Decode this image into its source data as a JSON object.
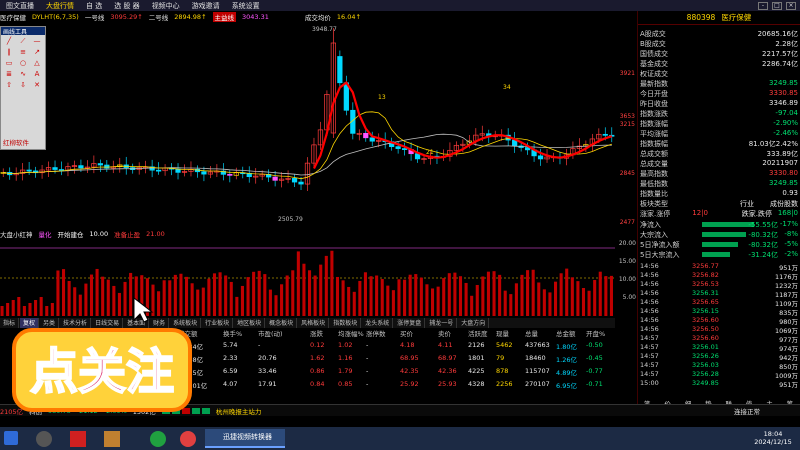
{
  "menubar": {
    "items": [
      "图文直播",
      "大盘行情",
      "自 选",
      "选 股 器",
      "视频中心",
      "游戏邀请",
      "系统设置"
    ],
    "highlight_index": 1,
    "controls": [
      "-",
      "□",
      "×"
    ]
  },
  "infobar": {
    "name": "医疗保健",
    "indicator": "DYLHT(6,7,35)",
    "line1_label": "一号线",
    "line1_value": "3095.29↑",
    "line2_label": "二号线",
    "line2_value": "2894.98↑",
    "tag": "主益线",
    "tag_value": "3043.31",
    "avg_label": "成交均价",
    "avg_value": "16.04↑"
  },
  "main_chart": {
    "y_ticks": [
      "3921",
      "3653",
      "3215",
      "2845",
      "2477"
    ],
    "high_label": "3948.77",
    "low_label": "2505.79",
    "annotations": [
      "13",
      "34",
      "21"
    ]
  },
  "indicator_bar": {
    "name": "大盘小红神",
    "a": "量化",
    "b": "开始建仓",
    "b_val": "10.00",
    "c": "准备止盈",
    "c_val": "21.00"
  },
  "vol_y_ticks": [
    "20.00",
    "15.00",
    "10.00",
    "5.00"
  ],
  "tabs": [
    "指标",
    "复权",
    "另类",
    "技术分析",
    "日线交易",
    "基本面",
    "财务",
    "系统板块",
    "行业板块",
    "地区板块",
    "概念板块",
    "风格板块",
    "指数板块",
    "龙头系统",
    "涨停复盘",
    "捕龙一号",
    "大盘方向"
  ],
  "tabs_active": 1,
  "table": {
    "headers": [
      "成交额",
      "换手%",
      "市盈(动)",
      "涨跌",
      "均涨幅%",
      "涨停数",
      "买价",
      "卖价",
      "活跃度",
      "现量",
      "总量",
      "总金额",
      "开盘%"
    ],
    "rows": [
      [
        "31.34亿",
        "5.74",
        "-",
        "0.12",
        "1.02",
        "-",
        "4.18",
        "4.11",
        "2126",
        "5462",
        "437663",
        "1.80亿",
        "-0.50"
      ],
      [
        "54.68亿",
        "2.33",
        "20.76",
        "1.62",
        "1.16",
        "-",
        "68.95",
        "68.97",
        "1801",
        "79",
        "18460",
        "1.26亿",
        "-0.45"
      ],
      [
        "74.35亿",
        "6.59",
        "33.46",
        "0.86",
        "1.79",
        "-",
        "42.35",
        "42.36",
        "4225",
        "878",
        "115707",
        "4.89亿",
        "-0.77"
      ],
      [
        "172.01亿",
        "4.07",
        "17.91",
        "0.84",
        "0.85",
        "-",
        "25.92",
        "25.93",
        "4328",
        "2256",
        "270107",
        "6.95亿",
        "-0.71"
      ]
    ]
  },
  "panel": {
    "code": "880398",
    "name": "医疗保健",
    "rows": [
      {
        "k": "A股成交",
        "v": "20685.16亿",
        "c": "c-wht"
      },
      {
        "k": "B股成交",
        "v": "2.28亿",
        "c": "c-wht"
      },
      {
        "k": "国债成交",
        "v": "2217.57亿",
        "c": "c-wht"
      },
      {
        "k": "基金成交",
        "v": "2286.74亿",
        "c": "c-wht"
      },
      {
        "k": "权证成交",
        "v": "",
        "c": "c-wht"
      },
      {
        "k": "最新指数",
        "v": "3249.85",
        "c": "c-grn"
      },
      {
        "k": "今日开盘",
        "v": "3330.85",
        "c": "c-red"
      },
      {
        "k": "昨日收盘",
        "v": "3346.89",
        "c": "c-wht"
      },
      {
        "k": "指数涨跌",
        "v": "-97.04",
        "c": "c-grn"
      },
      {
        "k": "指数涨幅",
        "v": "-2.90%",
        "c": "c-grn"
      },
      {
        "k": "平均涨幅",
        "v": "-2.46%",
        "c": "c-grn"
      },
      {
        "k": "指数振幅",
        "v": "81.03亿2.42%",
        "c": "c-wht"
      },
      {
        "k": "总成交额",
        "v": "333.89亿",
        "c": "c-wht"
      },
      {
        "k": "总成交量",
        "v": "20211907",
        "c": "c-wht"
      },
      {
        "k": "最高指数",
        "v": "3330.80",
        "c": "c-red"
      },
      {
        "k": "最低指数",
        "v": "3249.85",
        "c": "c-grn"
      },
      {
        "k": "指数量比",
        "v": "0.93",
        "c": "c-wht"
      }
    ],
    "sector": {
      "k": "板块类型",
      "v1": "行业",
      "v2": "成份股数"
    },
    "updown": {
      "k": "涨家.涨停",
      "v1": "12|0",
      "v2": "跌家.跌停",
      "v3": "168|0"
    },
    "flows": [
      {
        "k": "净流入",
        "v": "-55.55亿",
        "p": "-17%"
      },
      {
        "k": "大宗流入",
        "v": "-80.32亿",
        "p": "-8%"
      },
      {
        "k": "5日净流入额",
        "v": "-80.32亿",
        "p": "-5%"
      },
      {
        "k": "5日大宗流入",
        "v": "-31.24亿",
        "p": "-2%"
      }
    ],
    "ticks": [
      [
        "14:56",
        "3256.77",
        "951万"
      ],
      [
        "14:56",
        "3256.82",
        "1176万"
      ],
      [
        "14:56",
        "3256.53",
        "1232万"
      ],
      [
        "14:56",
        "3256.31",
        "1187万"
      ],
      [
        "14:56",
        "3256.65",
        "1109万"
      ],
      [
        "14:56",
        "3256.15",
        "835万"
      ],
      [
        "14:56",
        "3256.60",
        "980万"
      ],
      [
        "14:56",
        "3256.50",
        "1069万"
      ],
      [
        "14:57",
        "3256.60",
        "977万"
      ],
      [
        "14:57",
        "3256.01",
        "974万"
      ],
      [
        "14:57",
        "3256.26",
        "942万"
      ],
      [
        "14:57",
        "3256.03",
        "850万"
      ],
      [
        "14:57",
        "3256.28",
        "1009万"
      ],
      [
        "15:00",
        "3249.85",
        "951万"
      ]
    ],
    "bottom_tabs": [
      "笔",
      "价",
      "细",
      "势",
      "联",
      "值",
      "主",
      "筹"
    ]
  },
  "statusbar": {
    "left": "2105亿",
    "label": "科创",
    "v1": "989.78",
    "v2": "-21.12",
    "v3": "-2.09%",
    "v4": "1502亿",
    "news": "杭州晚报主站力",
    "right": "连接正常"
  },
  "taskbar": {
    "window_label": "迅捷视频转换器",
    "time": "18:04",
    "date": "2024/12/15"
  },
  "toolbox": {
    "title": "画线工具",
    "footer": "红柳软件"
  },
  "stamp": {
    "text": "点关注"
  },
  "colors": {
    "up": "#ff3b3b",
    "down": "#00e070",
    "highlight": "#ffd700",
    "ma_red": "#ff0000"
  }
}
